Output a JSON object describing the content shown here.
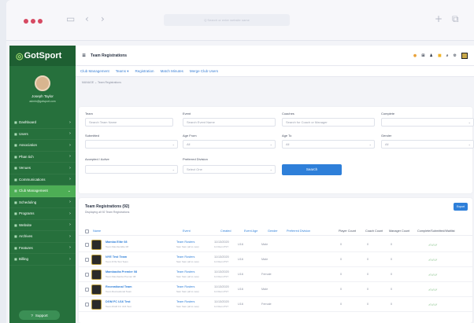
{
  "browser": {
    "url_text": "Q Search or enter website name"
  },
  "brand": {
    "logo": "GotSport"
  },
  "user": {
    "name": "Joseph Taylor",
    "email": "admin@gotsport.com"
  },
  "sidebar": {
    "items": [
      {
        "label": "Dashboard",
        "icon": "dashboard-icon"
      },
      {
        "label": "Users",
        "icon": "users-icon"
      },
      {
        "label": "Association",
        "icon": "association-icon"
      },
      {
        "label": "Phan tich",
        "icon": "analytics-icon"
      },
      {
        "label": "Venues",
        "icon": "venues-icon"
      },
      {
        "label": "Communications",
        "icon": "communications-icon"
      },
      {
        "label": "Club Management",
        "icon": "club-icon",
        "active": true
      },
      {
        "label": "Scheduling",
        "icon": "scheduling-icon"
      },
      {
        "label": "Programs",
        "icon": "programs-icon"
      },
      {
        "label": "Website",
        "icon": "website-icon"
      },
      {
        "label": "Archives",
        "icon": "archives-icon"
      },
      {
        "label": "Features",
        "icon": "features-icon"
      },
      {
        "label": "Billing",
        "icon": "billing-icon"
      }
    ],
    "support": "Support"
  },
  "header": {
    "title": "Team Registrations"
  },
  "subnav": [
    "Club Management",
    "Teams ▾",
    "Registration",
    "Match Minutes",
    "Merge Club Users"
  ],
  "breadcrumb": "MANAGE ⌄  Team Registrations",
  "filters": {
    "team": {
      "label": "Team",
      "placeholder": "Search Team Name"
    },
    "event": {
      "label": "Event",
      "placeholder": "Search Event Name"
    },
    "coaches": {
      "label": "Coaches",
      "placeholder": "Search for Coach or Manager"
    },
    "complete": {
      "label": "Complete",
      "value": ""
    },
    "submitted": {
      "label": "Submitted",
      "value": ""
    },
    "age_from": {
      "label": "Age From",
      "value": "All"
    },
    "age_to": {
      "label": "Age To",
      "value": "All"
    },
    "gender": {
      "label": "Gender",
      "value": "All"
    },
    "accepted": {
      "label": "Accepted / Active",
      "value": ""
    },
    "division": {
      "label": "Preferred Division",
      "value": "Select One"
    },
    "search_button": "Search"
  },
  "results": {
    "title": "Team Registrations (92)",
    "subtitle": "Displaying all 92 Team Registrations",
    "export": "Export",
    "columns": [
      "Name",
      "Event",
      "Created",
      "Event Age",
      "Gender",
      "Preferred Division",
      "Player Count",
      "Coach Count",
      "Manager Count",
      "Complete/Submitted/Waitlist"
    ],
    "rows": [
      {
        "name": "Mamba Elite 08",
        "sub": "Team Mamba Elite 08",
        "event": "Team Rosters",
        "event_sub": "Sam Sam (all to new)",
        "created": "11/13/2020",
        "created_sub": "11:01am PST",
        "age": "U16",
        "gender": "Male",
        "div": "",
        "players": "0",
        "coaches": "0",
        "managers": "0",
        "status": "✓/✓/✓"
      },
      {
        "name": "NYE Test Team",
        "sub": "Team NYE Test Team",
        "event": "Team Rosters",
        "event_sub": "Sam Sam (all to new)",
        "created": "11/13/2020",
        "created_sub": "11:01am PST",
        "age": "U16",
        "gender": "Male",
        "div": "",
        "players": "0",
        "coaches": "0",
        "managers": "0",
        "status": "✓/✓/✓"
      },
      {
        "name": "Mambacita Premier 08",
        "sub": "Team Mambacita Premier 08",
        "event": "Team Rosters",
        "event_sub": "Sam Sam (all to new)",
        "created": "11/13/2020",
        "created_sub": "11:01am PST",
        "age": "U16",
        "gender": "Female",
        "div": "",
        "players": "0",
        "coaches": "0",
        "managers": "0",
        "status": "✓/✓/✓"
      },
      {
        "name": "Recreational Team",
        "sub": "Team Recreational Team",
        "event": "Team Rosters",
        "event_sub": "Sam Sam (all to new)",
        "created": "11/13/2020",
        "created_sub": "11:01am PST",
        "age": "U16",
        "gender": "Male",
        "div": "",
        "players": "0",
        "coaches": "0",
        "managers": "0",
        "status": "✓/✓/✓"
      },
      {
        "name": "DGM FC U16 Test",
        "sub": "Team DGM FC U16 Test",
        "event": "Team Rosters",
        "event_sub": "Sam Sam (all to new)",
        "created": "11/13/2020",
        "created_sub": "11:01am PST",
        "age": "U16",
        "gender": "Female",
        "div": "",
        "players": "0",
        "coaches": "0",
        "managers": "0",
        "status": "✓/✓/✓"
      }
    ]
  },
  "colors": {
    "sidebar": "#26703c",
    "active": "#4dae55",
    "accent": "#2e7fd9"
  }
}
